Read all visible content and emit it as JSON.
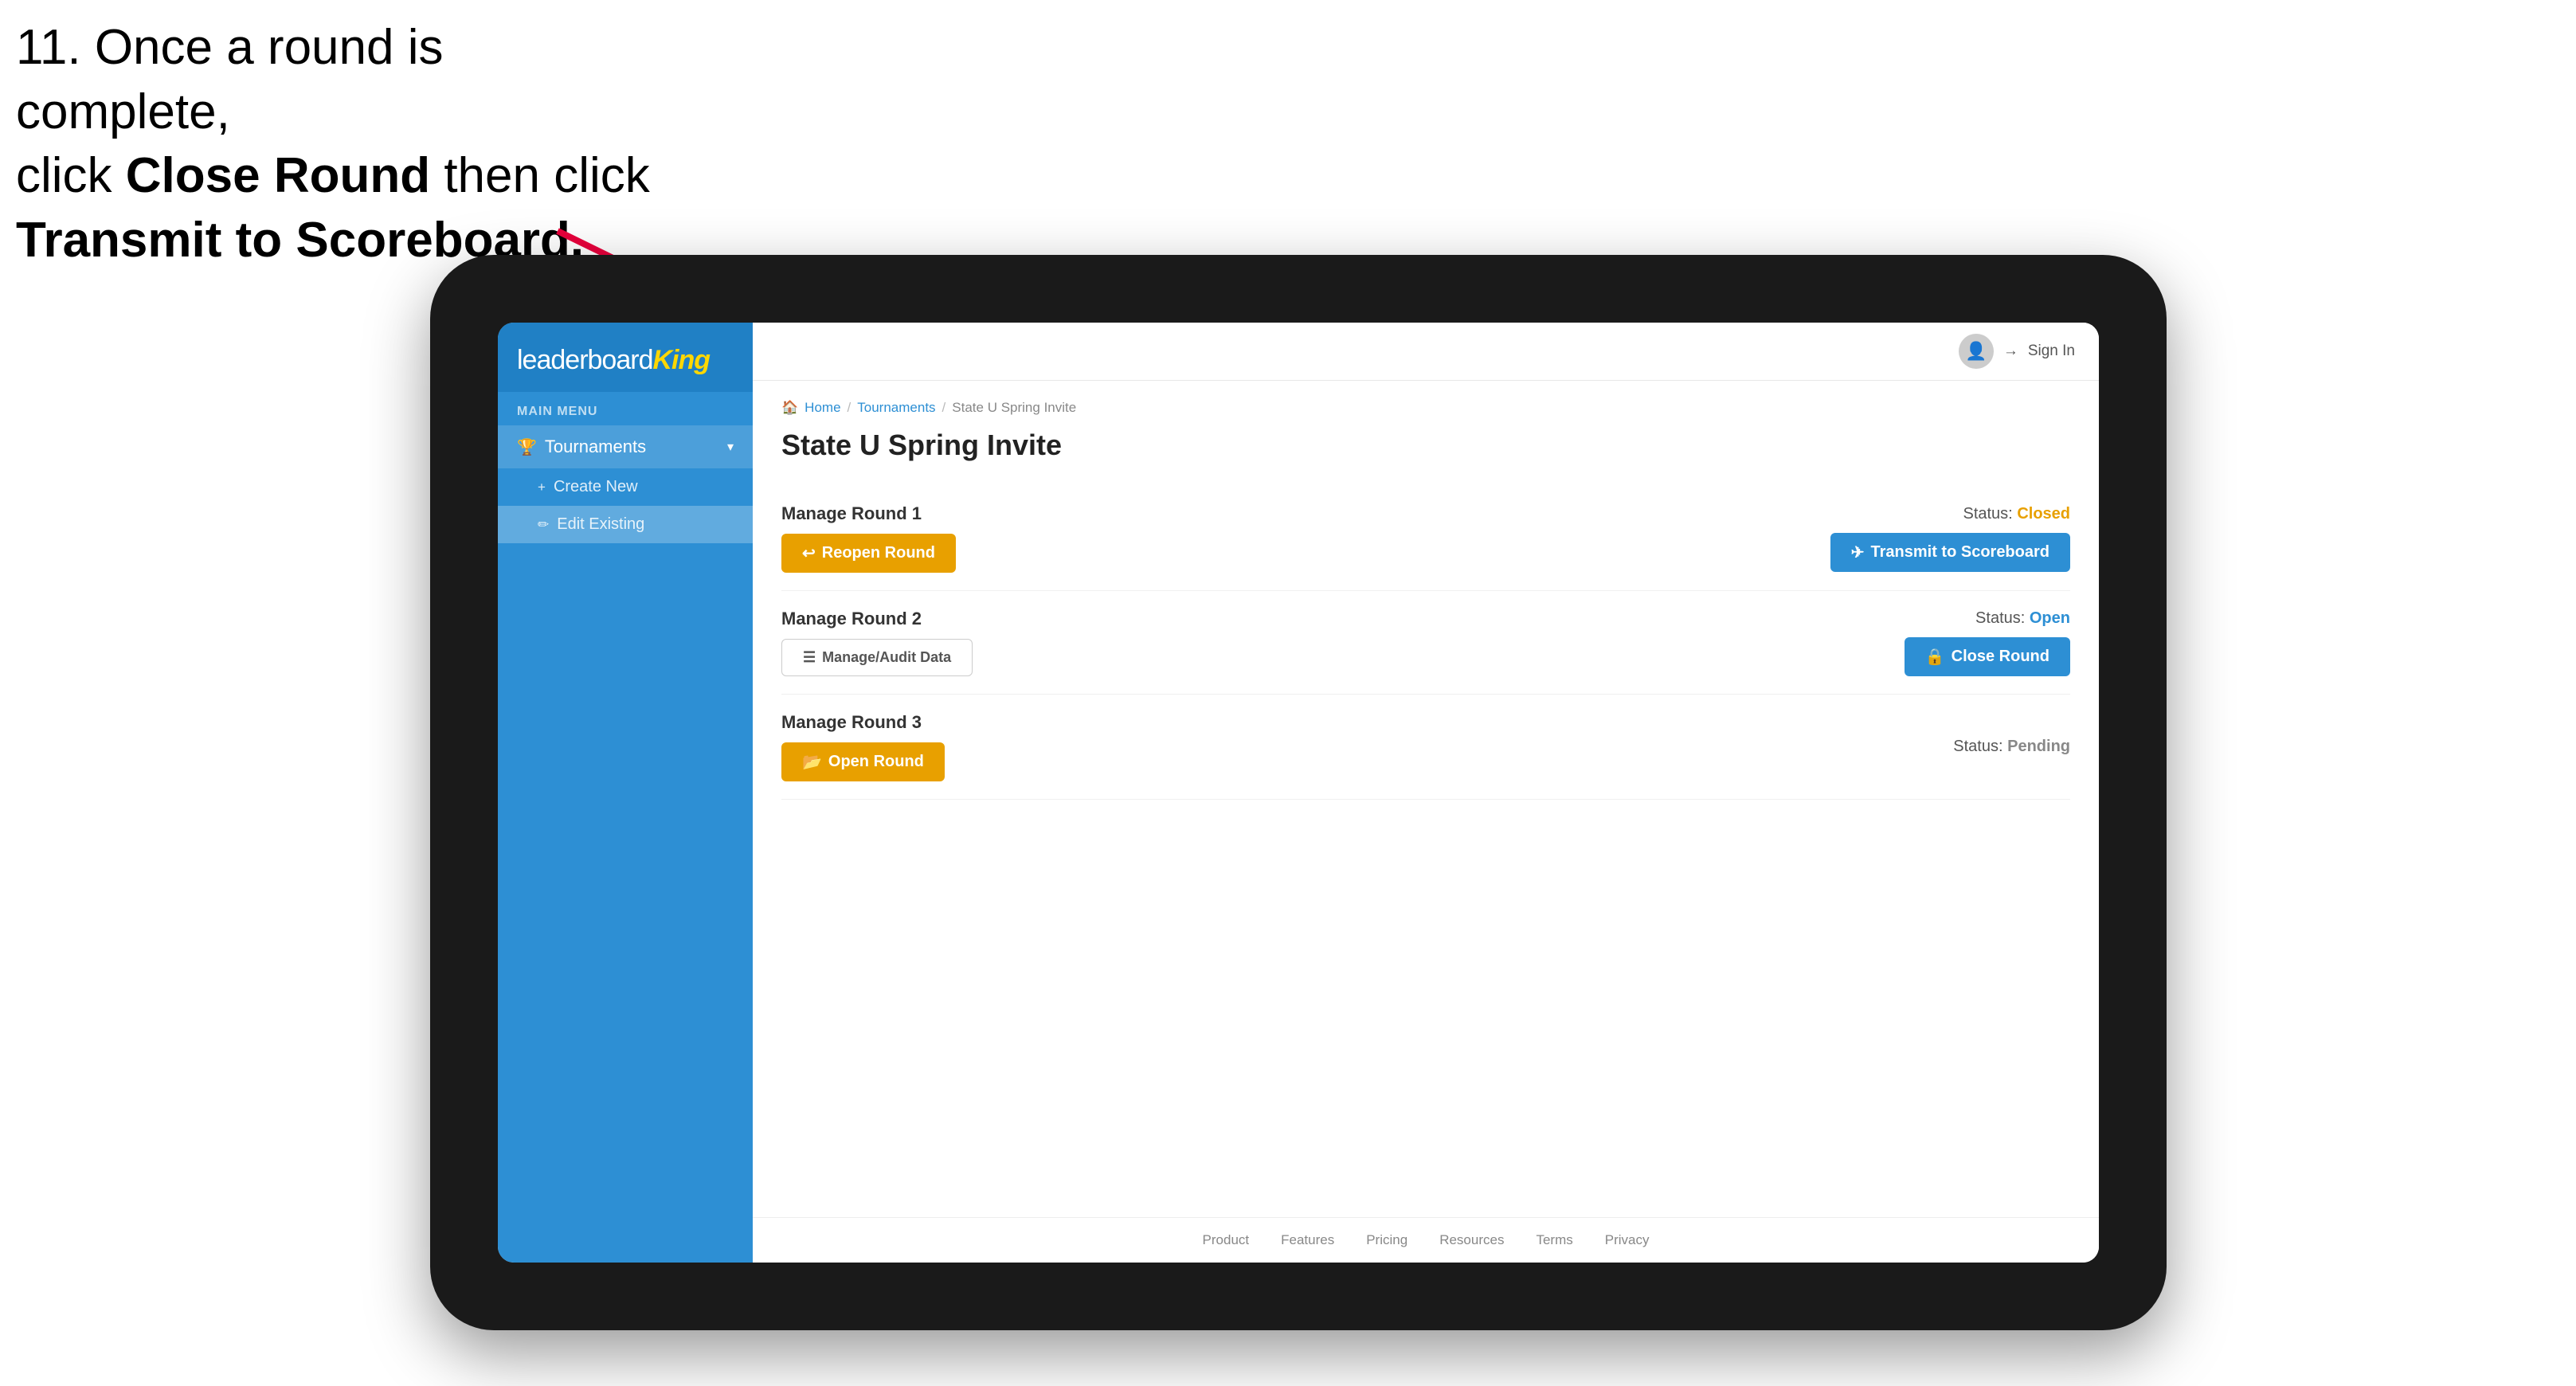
{
  "instruction": {
    "line1": "11. Once a round is complete,",
    "line2": "click ",
    "bold1": "Close Round",
    "line3": " then click",
    "bold2": "Transmit to Scoreboard."
  },
  "app": {
    "logo": {
      "prefix": "leaderboard",
      "highlight": "King"
    },
    "sidebar": {
      "main_menu_label": "MAIN MENU",
      "tournaments_label": "Tournaments",
      "tournaments_icon": "🏆",
      "create_new_label": "Create New",
      "create_new_icon": "+",
      "edit_existing_label": "Edit Existing",
      "edit_existing_icon": "✏"
    },
    "topbar": {
      "sign_in_label": "Sign In",
      "sign_in_icon": "→"
    },
    "breadcrumb": {
      "home": "Home",
      "tournaments": "Tournaments",
      "current": "State U Spring Invite"
    },
    "page_title": "State U Spring Invite",
    "rounds": [
      {
        "id": "round1",
        "title": "Manage Round 1",
        "status_label": "Status:",
        "status_value": "Closed",
        "status_class": "status-closed",
        "buttons": [
          {
            "id": "reopen",
            "label": "Reopen Round",
            "icon": "↩",
            "style": "btn-amber"
          },
          {
            "id": "transmit",
            "label": "Transmit to Scoreboard",
            "icon": "✈",
            "style": "btn-blue"
          }
        ]
      },
      {
        "id": "round2",
        "title": "Manage Round 2",
        "status_label": "Status:",
        "status_value": "Open",
        "status_class": "status-open",
        "buttons": [
          {
            "id": "audit",
            "label": "Manage/Audit Data",
            "icon": "☰",
            "style": "btn-outline"
          },
          {
            "id": "close",
            "label": "Close Round",
            "icon": "🔒",
            "style": "btn-blue"
          }
        ]
      },
      {
        "id": "round3",
        "title": "Manage Round 3",
        "status_label": "Status:",
        "status_value": "Pending",
        "status_class": "status-pending",
        "buttons": [
          {
            "id": "open",
            "label": "Open Round",
            "icon": "📂",
            "style": "btn-amber"
          }
        ]
      }
    ],
    "footer": {
      "links": [
        "Product",
        "Features",
        "Pricing",
        "Resources",
        "Terms",
        "Privacy"
      ]
    }
  }
}
